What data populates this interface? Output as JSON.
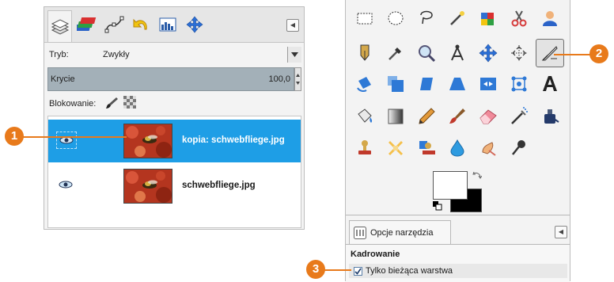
{
  "layers_panel": {
    "mode_label": "Tryb:",
    "mode_value": "Zwykły",
    "opacity_label": "Krycie",
    "opacity_value": "100,0",
    "lock_label": "Blokowanie:",
    "layers": [
      {
        "name": "kopia: schwebfliege.jpg",
        "visible": true,
        "selected": true
      },
      {
        "name": "schwebfliege.jpg",
        "visible": true,
        "selected": false
      }
    ]
  },
  "toolbox": {
    "tool_options_tab": "Opcje narzędzia",
    "section_title": "Kadrowanie",
    "checkbox_label": "Tylko bieżąca warstwa",
    "checkbox_checked": true
  },
  "callouts": {
    "c1": "1",
    "c2": "2",
    "c3": "3"
  },
  "colors": {
    "selection": "#1e9ee6",
    "callout": "#e87a1b",
    "opacity_bar": "#a3b0b8"
  }
}
